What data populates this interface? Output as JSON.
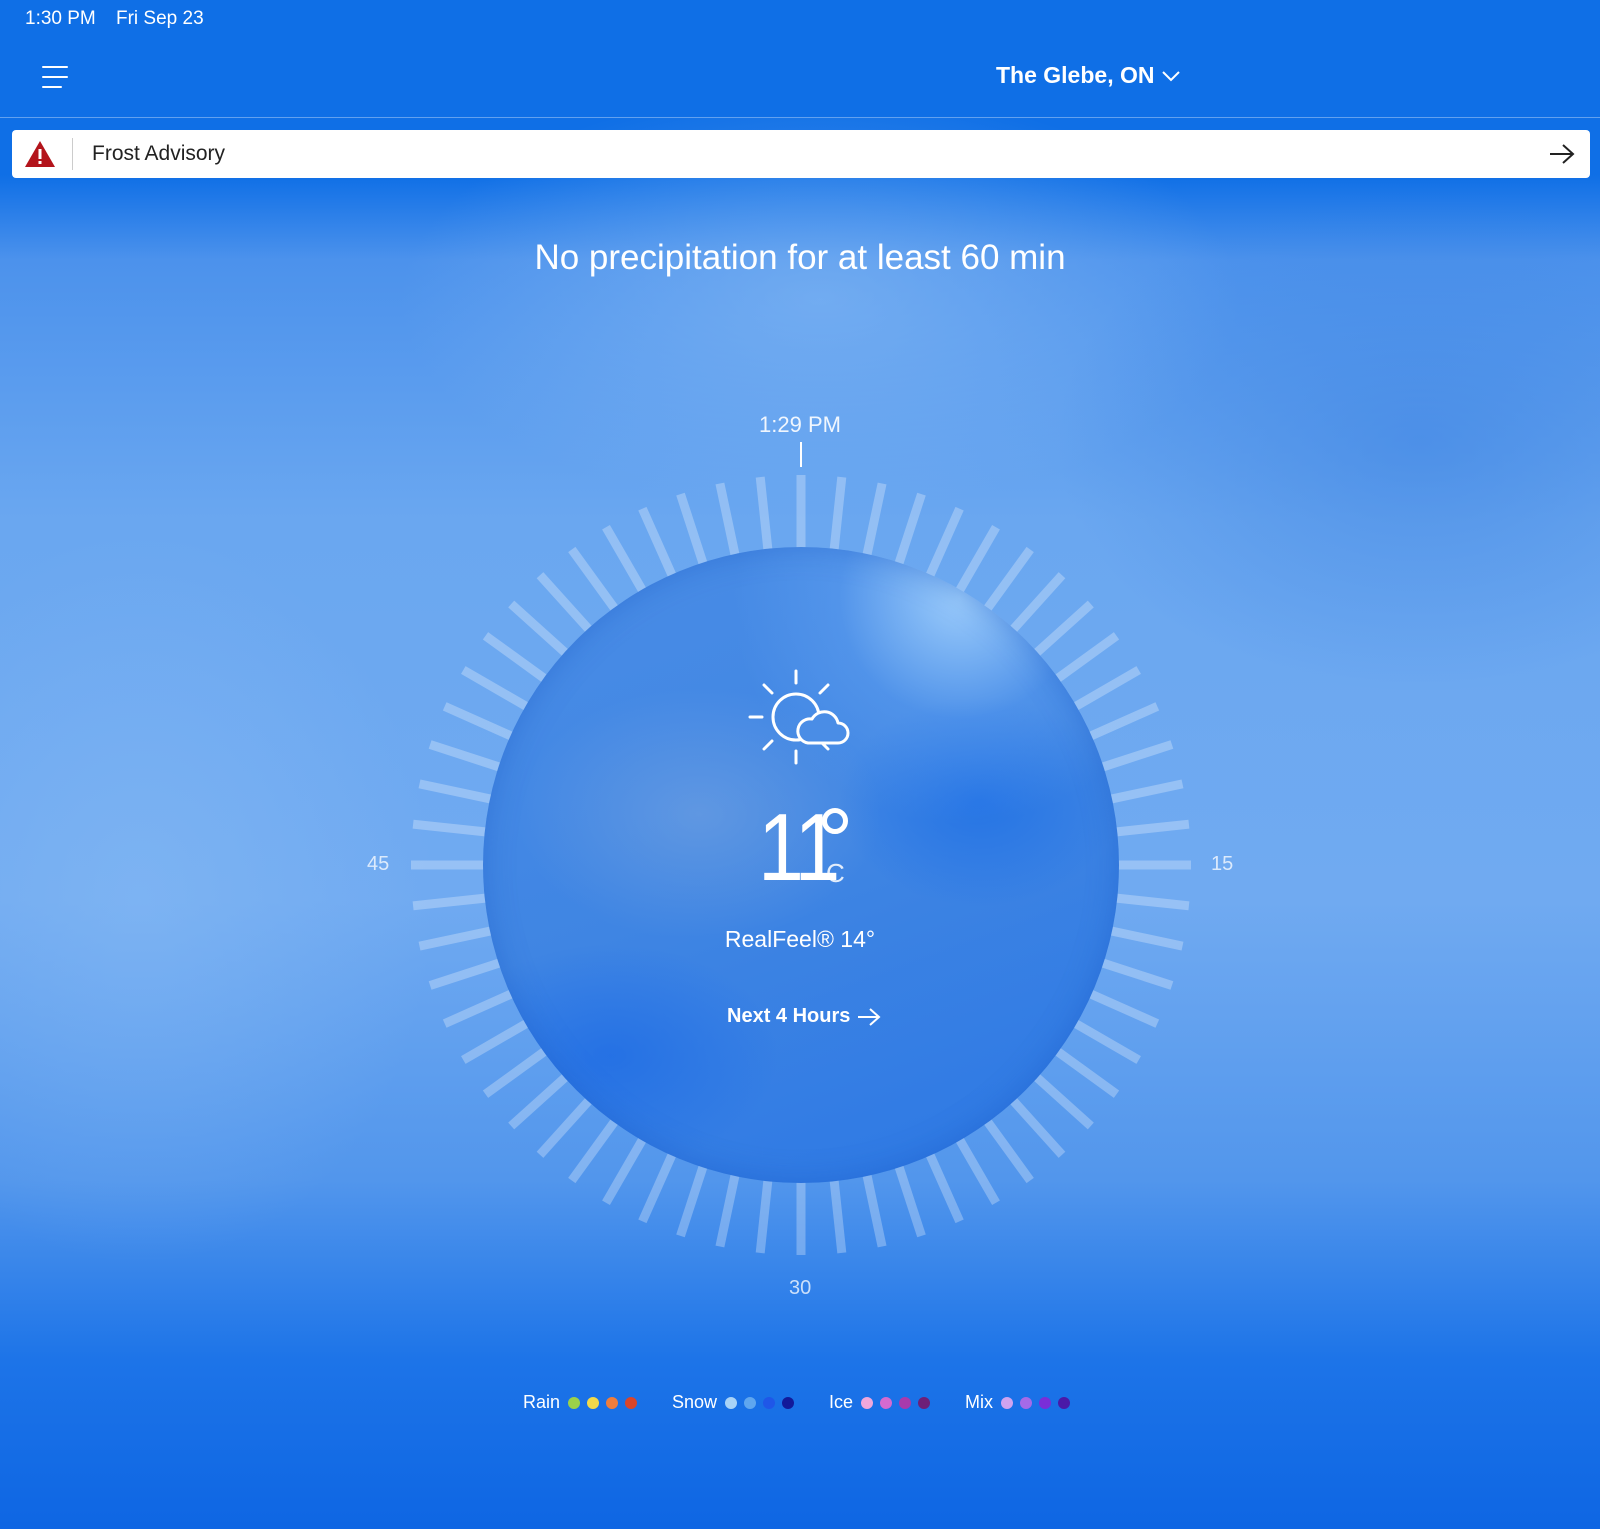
{
  "status_bar": {
    "time": "1:30 PM",
    "date": "Fri Sep 23"
  },
  "header": {
    "location": "The Glebe, ON"
  },
  "alert": {
    "label": "Frost Advisory"
  },
  "headline": "No precipitation for at least 60 min",
  "dial": {
    "current_time": "1:29 PM",
    "labels": {
      "right": "15",
      "bottom": "30",
      "left": "45"
    }
  },
  "current": {
    "temperature": "11",
    "unit": "C",
    "realfeel": "RealFeel® 14°",
    "next_link": "Next 4 Hours",
    "icon": "partly-sunny-icon"
  },
  "legend": [
    {
      "name": "Rain",
      "colors": [
        "#9bd14a",
        "#f2d94a",
        "#ef7d3c",
        "#d9452a"
      ]
    },
    {
      "name": "Snow",
      "colors": [
        "#a9d3f7",
        "#5fa6ef",
        "#1f57e8",
        "#121a9a"
      ]
    },
    {
      "name": "Ice",
      "colors": [
        "#efa7dc",
        "#d46ad0",
        "#a83aac",
        "#6e1f78"
      ]
    },
    {
      "name": "Mix",
      "colors": [
        "#cfa3f0",
        "#a56ae8",
        "#7a2ed8",
        "#4a19a8"
      ]
    }
  ],
  "colors": {
    "header_bg": "#0f6fe6",
    "alert_icon": "#b3141b"
  }
}
